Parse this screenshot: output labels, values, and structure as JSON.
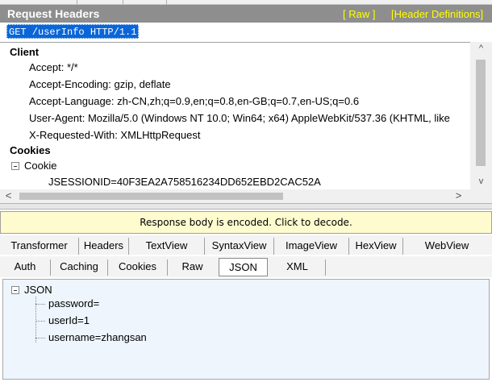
{
  "header": {
    "title": "Request Headers",
    "raw_link": "[ Raw ]",
    "definitions_link": "[Header Definitions]"
  },
  "request_line": "GET /userInfo HTTP/1.1",
  "headers": {
    "client_group": "Client",
    "client_items": [
      "Accept: */*",
      "Accept-Encoding: gzip, deflate",
      "Accept-Language: zh-CN,zh;q=0.9,en;q=0.8,en-GB;q=0.7,en-US;q=0.6",
      "User-Agent: Mozilla/5.0 (Windows NT 10.0; Win64; x64) AppleWebKit/537.36 (KHTML, like",
      "X-Requested-With: XMLHttpRequest"
    ],
    "cookies_group": "Cookies",
    "cookie_parent": "Cookie",
    "cookie_value": "JSESSIONID=40F3EA2A758516234DD652EBD2CAC52A"
  },
  "scroll": {
    "up_arrow": "^",
    "down_arrow": "v",
    "left_arrow": "<",
    "right_arrow": ">"
  },
  "response_notice": "Response body is encoded. Click to decode.",
  "response_tabs_row1": [
    "Transformer",
    "Headers",
    "TextView",
    "SyntaxView",
    "ImageView",
    "HexView",
    "WebView"
  ],
  "response_tabs_row2": [
    "Auth",
    "Caching",
    "Cookies",
    "Raw",
    "JSON",
    "XML"
  ],
  "active_tab": "JSON",
  "json_tree": {
    "root": "JSON",
    "children": [
      "password=",
      "userId=1",
      "username=zhangsan"
    ]
  },
  "colors": {
    "header_bg": "#8e8e8e",
    "header_link": "#ffff00",
    "selection": "#0a66d8",
    "notice_bg": "#fefccf",
    "json_bg": "#eef5fd"
  }
}
